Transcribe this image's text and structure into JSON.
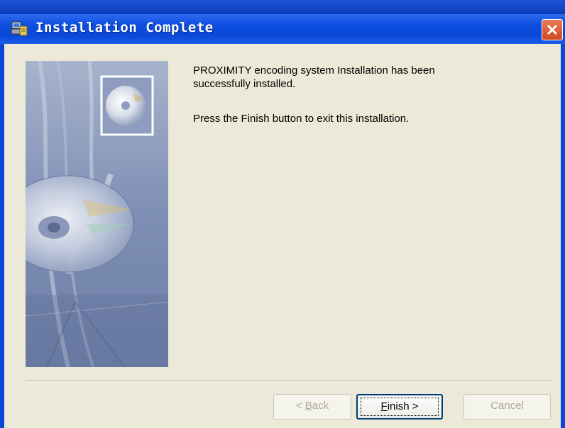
{
  "window": {
    "title": "Installation Complete",
    "title_icon": "installer-icon",
    "close_icon": "close-icon"
  },
  "side_image": {
    "icon": "cd-disc-illustration"
  },
  "message": {
    "line1": "PROXIMITY encoding system Installation has been successfully installed.",
    "line2": "Press the Finish button to exit this installation."
  },
  "buttons": {
    "back": {
      "mnemonic": "B",
      "rest": "ack",
      "prefix": "< ",
      "enabled": false
    },
    "finish": {
      "mnemonic": "F",
      "rest": "inish >",
      "enabled": true
    },
    "cancel": {
      "label": "Cancel",
      "enabled": false
    }
  },
  "colors": {
    "titlebar": "#0a47d8",
    "dialog_bg": "#ece9d8",
    "close_button": "#d1481f"
  }
}
